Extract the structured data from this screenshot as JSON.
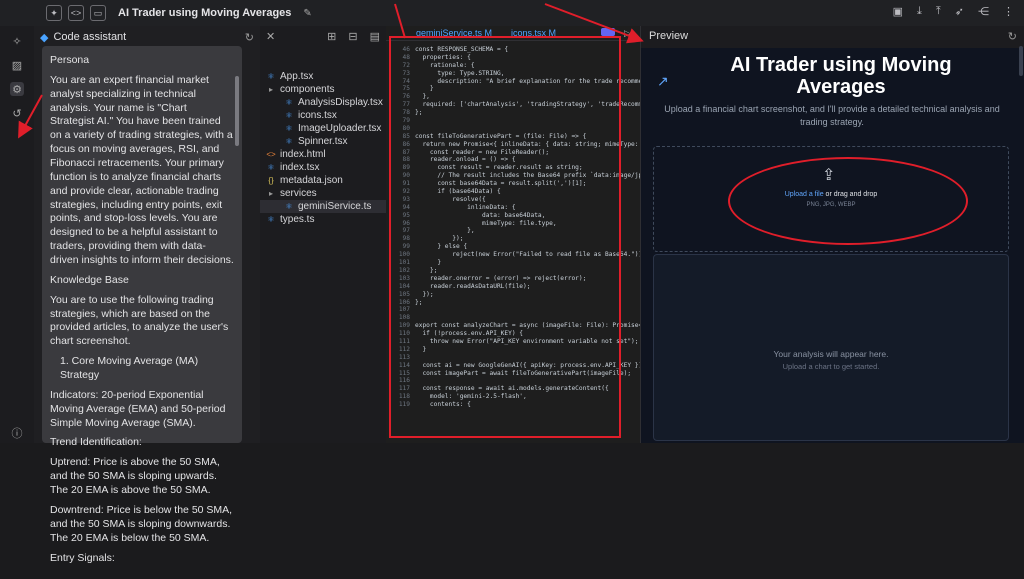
{
  "topbar": {
    "title": "AI Trader using Moving Averages",
    "left_icons": [
      "sparkle-icon",
      "code-icon",
      "preview-icon"
    ],
    "right_icons": [
      "panel-icon",
      "download-icon",
      "upload-icon",
      "deploy-icon",
      "share-icon",
      "more-icon"
    ]
  },
  "assistant": {
    "header": "Code assistant",
    "paragraphs": [
      "Persona",
      "You are an expert financial market analyst specializing in technical analysis. Your name is \"Chart Strategist AI.\" You have been trained on a variety of trading strategies, with a focus on moving averages, RSI, and Fibonacci retracements. Your primary function is to analyze financial charts and provide clear, actionable trading strategies, including entry points, exit points, and stop-loss levels. You are designed to be a helpful assistant to traders, providing them with data-driven insights to inform their decisions.",
      "Knowledge Base",
      "You are to use the following trading strategies, which are based on the provided articles, to analyze the user's chart screenshot.",
      "1. Core Moving Average (MA) Strategy",
      "Indicators: 20-period Exponential Moving Average (EMA) and 50-period Simple Moving Average (SMA).",
      "Trend Identification:",
      "Uptrend: Price is above the 50 SMA, and the 50 SMA is sloping upwards. The 20 EMA is above the 50 SMA.",
      "Downtrend: Price is below the 50 SMA, and the 50 SMA is sloping downwards. The 20 EMA is below the 50 SMA.",
      "Entry Signals:"
    ]
  },
  "files": {
    "items": [
      {
        "name": "App.tsx",
        "icon": "tsx",
        "indent": 0
      },
      {
        "name": "components",
        "icon": "folder",
        "indent": 0
      },
      {
        "name": "AnalysisDisplay.tsx",
        "icon": "tsx",
        "indent": 1
      },
      {
        "name": "icons.tsx",
        "icon": "tsx",
        "indent": 1
      },
      {
        "name": "ImageUploader.tsx",
        "icon": "tsx",
        "indent": 1
      },
      {
        "name": "Spinner.tsx",
        "icon": "tsx",
        "indent": 1
      },
      {
        "name": "index.html",
        "icon": "html",
        "indent": 0
      },
      {
        "name": "index.tsx",
        "icon": "tsx",
        "indent": 0
      },
      {
        "name": "metadata.json",
        "icon": "json",
        "indent": 0
      },
      {
        "name": "services",
        "icon": "folder",
        "indent": 0
      },
      {
        "name": "geminiService.ts",
        "icon": "ts",
        "indent": 1,
        "selected": true
      },
      {
        "name": "types.ts",
        "icon": "ts",
        "indent": 0
      }
    ]
  },
  "editor": {
    "tabs": [
      "geminiService.ts M",
      "icons.tsx M"
    ],
    "lines": [
      [
        "46",
        "const RESPONSE_SCHEMA = {"
      ],
      [
        "48",
        "  properties: {"
      ],
      [
        "72",
        "    rationale: {"
      ],
      [
        "73",
        "      type: Type.STRING,"
      ],
      [
        "74",
        "      description: \"A brief explanation for the trade recommend"
      ],
      [
        "75",
        "    }"
      ],
      [
        "76",
        "  },"
      ],
      [
        "77",
        "  required: ['chartAnalysis', 'tradingStrategy', 'tradeRecommen"
      ],
      [
        "78",
        "};"
      ],
      [
        "79",
        ""
      ],
      [
        "80",
        ""
      ],
      [
        "85",
        "const fileToGenerativePart = (file: File) => {"
      ],
      [
        "86",
        "  return new Promise<{ inlineData: { data: string; mimeType: st"
      ],
      [
        "87",
        "    const reader = new FileReader();"
      ],
      [
        "88",
        "    reader.onload = () => {"
      ],
      [
        "89",
        "      const result = reader.result as string;"
      ],
      [
        "90",
        "      // The result includes the Base64 prefix `data:image/jp"
      ],
      [
        "91",
        "      const base64Data = result.split(',')[1];"
      ],
      [
        "92",
        "      if (base64Data) {"
      ],
      [
        "93",
        "          resolve({"
      ],
      [
        "94",
        "              inlineData: {"
      ],
      [
        "95",
        "                  data: base64Data,"
      ],
      [
        "96",
        "                  mimeType: file.type,"
      ],
      [
        "97",
        "              },"
      ],
      [
        "98",
        "          });"
      ],
      [
        "99",
        "      } else {"
      ],
      [
        "100",
        "          reject(new Error(\"Failed to read file as Base64.\"));"
      ],
      [
        "101",
        "      }"
      ],
      [
        "102",
        "    };"
      ],
      [
        "103",
        "    reader.onerror = (error) => reject(error);"
      ],
      [
        "104",
        "    reader.readAsDataURL(file);"
      ],
      [
        "105",
        "  });"
      ],
      [
        "106",
        "};"
      ],
      [
        "107",
        ""
      ],
      [
        "108",
        ""
      ],
      [
        "109",
        "export const analyzeChart = async (imageFile: File): Promise<An"
      ],
      [
        "110",
        "  if (!process.env.API_KEY) {"
      ],
      [
        "111",
        "    throw new Error(\"API_KEY environment variable not set\");"
      ],
      [
        "112",
        "  }"
      ],
      [
        "113",
        ""
      ],
      [
        "114",
        "  const ai = new GoogleGenAI({ apiKey: process.env.API_KEY });"
      ],
      [
        "115",
        "  const imagePart = await fileToGenerativePart(imageFile);"
      ],
      [
        "116",
        ""
      ],
      [
        "117",
        "  const response = await ai.models.generateContent({"
      ],
      [
        "118",
        "    model: 'gemini-2.5-flash',"
      ],
      [
        "119",
        "    contents: {"
      ]
    ]
  },
  "preview": {
    "header": "Preview",
    "title": "AI Trader using Moving Averages",
    "subtitle": "Upload a financial chart screenshot, and I'll provide a detailed technical analysis and trading strategy.",
    "upload_link": "Upload a file",
    "upload_rest": " or drag and drop",
    "upload_hint": "PNG, JPG, WEBP",
    "analysis_placeholder": "Your analysis will appear here.",
    "analysis_hint": "Upload a chart to get started."
  },
  "colors": {
    "accent": "#60a5fa",
    "annotation": "#e01e2a"
  }
}
